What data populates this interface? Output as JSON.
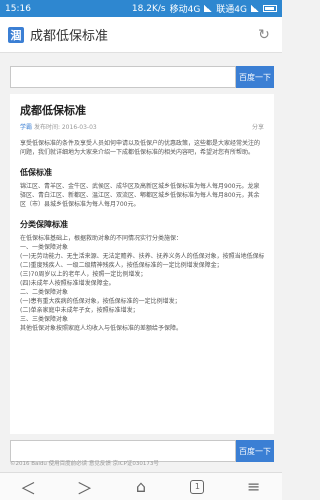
{
  "status": {
    "time": "15:16",
    "net_speed": "18.2K/s",
    "carrier1": "移动4G",
    "carrier2": "联通4G"
  },
  "browser": {
    "logo": "涸",
    "query": "成都低保标准",
    "refresh_icon": "↻"
  },
  "search": {
    "button": "百度一下",
    "placeholder": ""
  },
  "article": {
    "title": "成都低保标准",
    "author": "学霸",
    "meta": "发布时间: 2016-03-03",
    "share": "分享",
    "intro": "享受低保标准的条件及享受人员如何申请以及低保户的优惠政策，这些都是大家经常关注的问题，我们就详细地为大家来介绍一下成都低保标准的相关内容吧，希望对您有所帮助。",
    "section1_title": "低保标准",
    "section1_text": "锦江区、青羊区、金牛区、武侯区、成华区及高新区城乡低保标准为每人每月900元。龙泉驿区、青白江区、新都区、温江区、双流区、郫都区城乡低保标准为每人每月800元，其余区（市）县城乡低保标准为每人每月700元。",
    "section2_title": "分类保障标准",
    "section2_lines": [
      "在低保标准基础上，根据救助对象的不同情况实行分类施保：",
      "一、一类保障对象",
      "(一)无劳动能力、无生活来源、无法定赡养、扶养、抚养义务人的低保对象，按照当地低保标准全额给付；",
      "(二)重度残疾人、一级二级精神残疾人，按低保标准的一定比例增发保障金；",
      "(三)70周岁以上的老年人，按照一定比例增发；",
      "(四)未成年人按照标准增发保障金。",
      "二、二类保障对象",
      "(一)患有重大疾病的低保对象，按低保标准的一定比例增发；",
      "(二)单亲家庭中未成年子女，按照标准增发；",
      "三、三类保障对象",
      "其他低保对象按照家庭人均收入与低保标准的差额给予保障。"
    ]
  },
  "footer": "©2016 Baidu 使用百度前必读 意见反馈 京ICP证030173号",
  "nav": {
    "back": "＜",
    "forward": "＞",
    "home": "⌂",
    "tabs": "1",
    "menu": "≡"
  }
}
